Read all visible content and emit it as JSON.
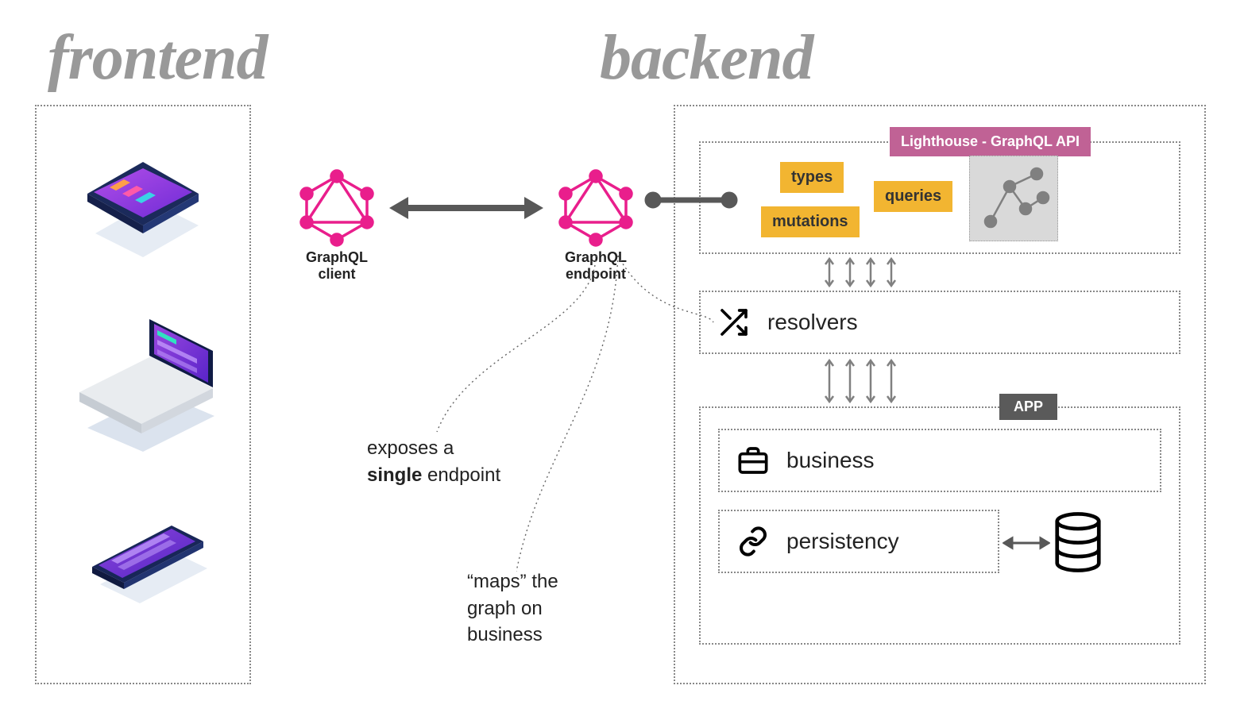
{
  "titles": {
    "frontend": "frontend",
    "backend": "backend"
  },
  "nodes": {
    "graphql_client": "GraphQL\nclient",
    "graphql_endpoint": "GraphQL\nendpoint"
  },
  "captions": {
    "exposes": "exposes a",
    "single": "single",
    "endpoint_suffix": " endpoint",
    "maps1": "“maps” the",
    "maps2": "graph on",
    "maps3": "business"
  },
  "badges": {
    "lighthouse": "Lighthouse - GraphQL API",
    "app": "APP"
  },
  "pills": {
    "types": "types",
    "queries": "queries",
    "mutations": "mutations"
  },
  "rows": {
    "resolvers": "resolvers",
    "business": "business",
    "persistency": "persistency"
  },
  "colors": {
    "graphql_pink": "#e91e8c",
    "badge_pink": "#c06295",
    "pill_yellow": "#f2b531",
    "title_gray": "#999999",
    "arrow_gray": "#585858"
  }
}
